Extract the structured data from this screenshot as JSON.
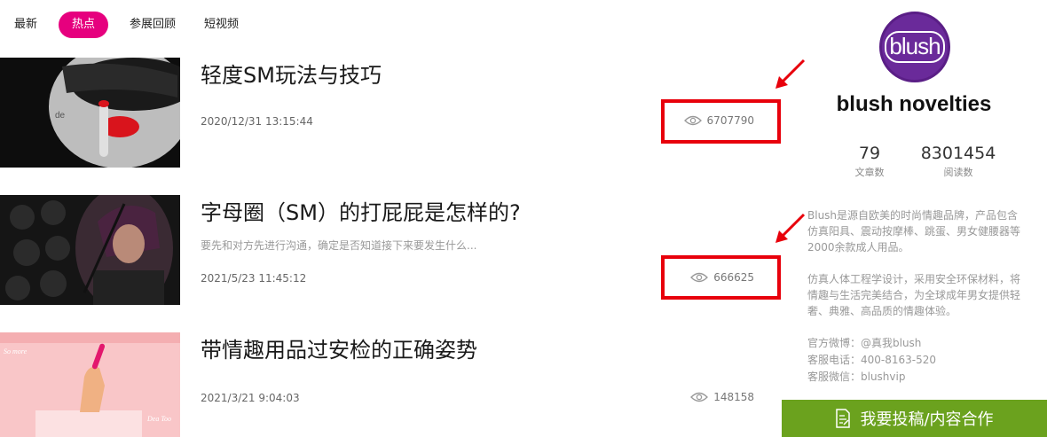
{
  "tabs": [
    {
      "label": "最新",
      "active": false
    },
    {
      "label": "热点",
      "active": true
    },
    {
      "label": "参展回顾",
      "active": false
    },
    {
      "label": "短视频",
      "active": false
    }
  ],
  "articles": [
    {
      "title": "轻度SM玩法与技巧",
      "description": "",
      "date": "2020/12/31 13:15:44",
      "views": "6707790",
      "highlighted": true
    },
    {
      "title": "字母圈（SM）的打屁屁是怎样的?",
      "description": "要先和对方先进行沟通，确定是否知道接下来要发生什么...",
      "date": "2021/5/23 11:45:12",
      "views": "666625",
      "highlighted": true
    },
    {
      "title": "带情趣用品过安检的正确姿势",
      "description": "",
      "date": "2021/3/21 9:04:03",
      "views": "148158",
      "highlighted": false
    }
  ],
  "sidebar": {
    "logo_text": "blush",
    "brand_name": "blush novelties",
    "stats": [
      {
        "value": "79",
        "label": "文章数"
      },
      {
        "value": "8301454",
        "label": "阅读数"
      }
    ],
    "bio": [
      "Blush是源自欧美的时尚情趣品牌，产品包含仿真阳具、震动按摩棒、跳蛋、男女健腰器等2000余款成人用品。",
      "仿真人体工程学设计，采用安全环保材料，将情趣与生活完美结合，为全球成年男女提供轻奢、典雅、高品质的情趣体验。"
    ],
    "contact": {
      "weibo": "官方微博：@真我blush",
      "phone": "客服电话：400-8163-520",
      "wechat": "客服微信：blushvip"
    },
    "cta_label": "我要投稿/内容合作"
  },
  "colors": {
    "accent": "#e6007e",
    "cta": "#6ba21e",
    "highlight": "#e8000b",
    "logo": "#6a2a9a"
  },
  "icons": {
    "views": "eye-icon",
    "cta": "document-edit-icon",
    "annotation": "red-arrow"
  }
}
